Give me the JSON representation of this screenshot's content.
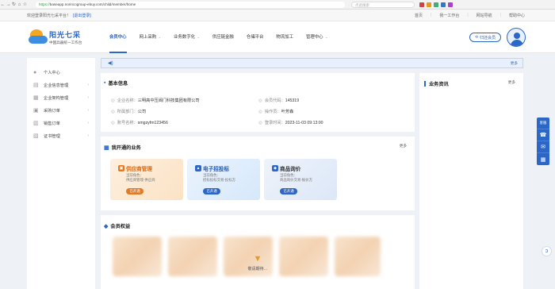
{
  "browser": {
    "url_scheme": "https://",
    "url_rest": "baseapp.norincogroup-ebuy.com/child/member/home",
    "search_placeholder": "点此搜索"
  },
  "topbar": {
    "welcome": "欢迎登录阳光七采平台！",
    "logout": "[退出登录]",
    "links": [
      "首页",
      "我一工作台",
      "网站导航",
      "帮助中心"
    ]
  },
  "brand": {
    "name": "阳光七采",
    "slogan": "中国兵器统一工作台"
  },
  "menu": [
    {
      "label": "会员中心",
      "caret": false
    },
    {
      "label": "网上采购",
      "caret": true
    },
    {
      "label": "业务数字化",
      "caret": true
    },
    {
      "label": "供应链金融",
      "caret": false
    },
    {
      "label": "仓储平台",
      "caret": false
    },
    {
      "label": "物流加工",
      "caret": false
    },
    {
      "label": "管理中心",
      "caret": true
    }
  ],
  "return_member": "归还会员",
  "sidebar": [
    "个人中心",
    "企业信息管理",
    "企业架构管理",
    "采购订单",
    "销售订单",
    "证书管理"
  ],
  "notice_more": "更多",
  "basic": {
    "title": "基本信息",
    "company_label": "企业名称：",
    "company": "三明高中压阀门科技集团有限公司",
    "member_code_label": "会员代码：",
    "member_code": "145319",
    "dept_label": "所属部门：",
    "dept": "公司",
    "operator_label": "操作员：",
    "operator": "叶芳森",
    "account_label": "账号名称：",
    "account": "smgzyfm123456",
    "login_label": "登录时间：",
    "login": "2023-11-03 09:13:00"
  },
  "news": {
    "title": "业务资讯",
    "more": "更多"
  },
  "business": {
    "title": "我开通的业务",
    "more": "更多",
    "cards": [
      {
        "title": "供应商管理",
        "line1": "当前角色：",
        "line2": "供应商管理-供应商",
        "btn": "已开通"
      },
      {
        "title": "电子招投标",
        "line1": "当前角色：",
        "line2": "招标投标交易-投标方",
        "btn": "已开通"
      },
      {
        "title": "商品询价",
        "line1": "当前角色：",
        "line2": "商品询价交易-报价方",
        "btn": "已开通"
      }
    ]
  },
  "benefits": {
    "title": "会员权益",
    "dev": "敬请期待…"
  },
  "right_tools": [
    "客服",
    "☎",
    "✉",
    "▦"
  ],
  "colors": {
    "primary": "#2b66c9",
    "card1": "#e67a22",
    "card2": "#2b66c9",
    "card3": "#2b66c9"
  }
}
